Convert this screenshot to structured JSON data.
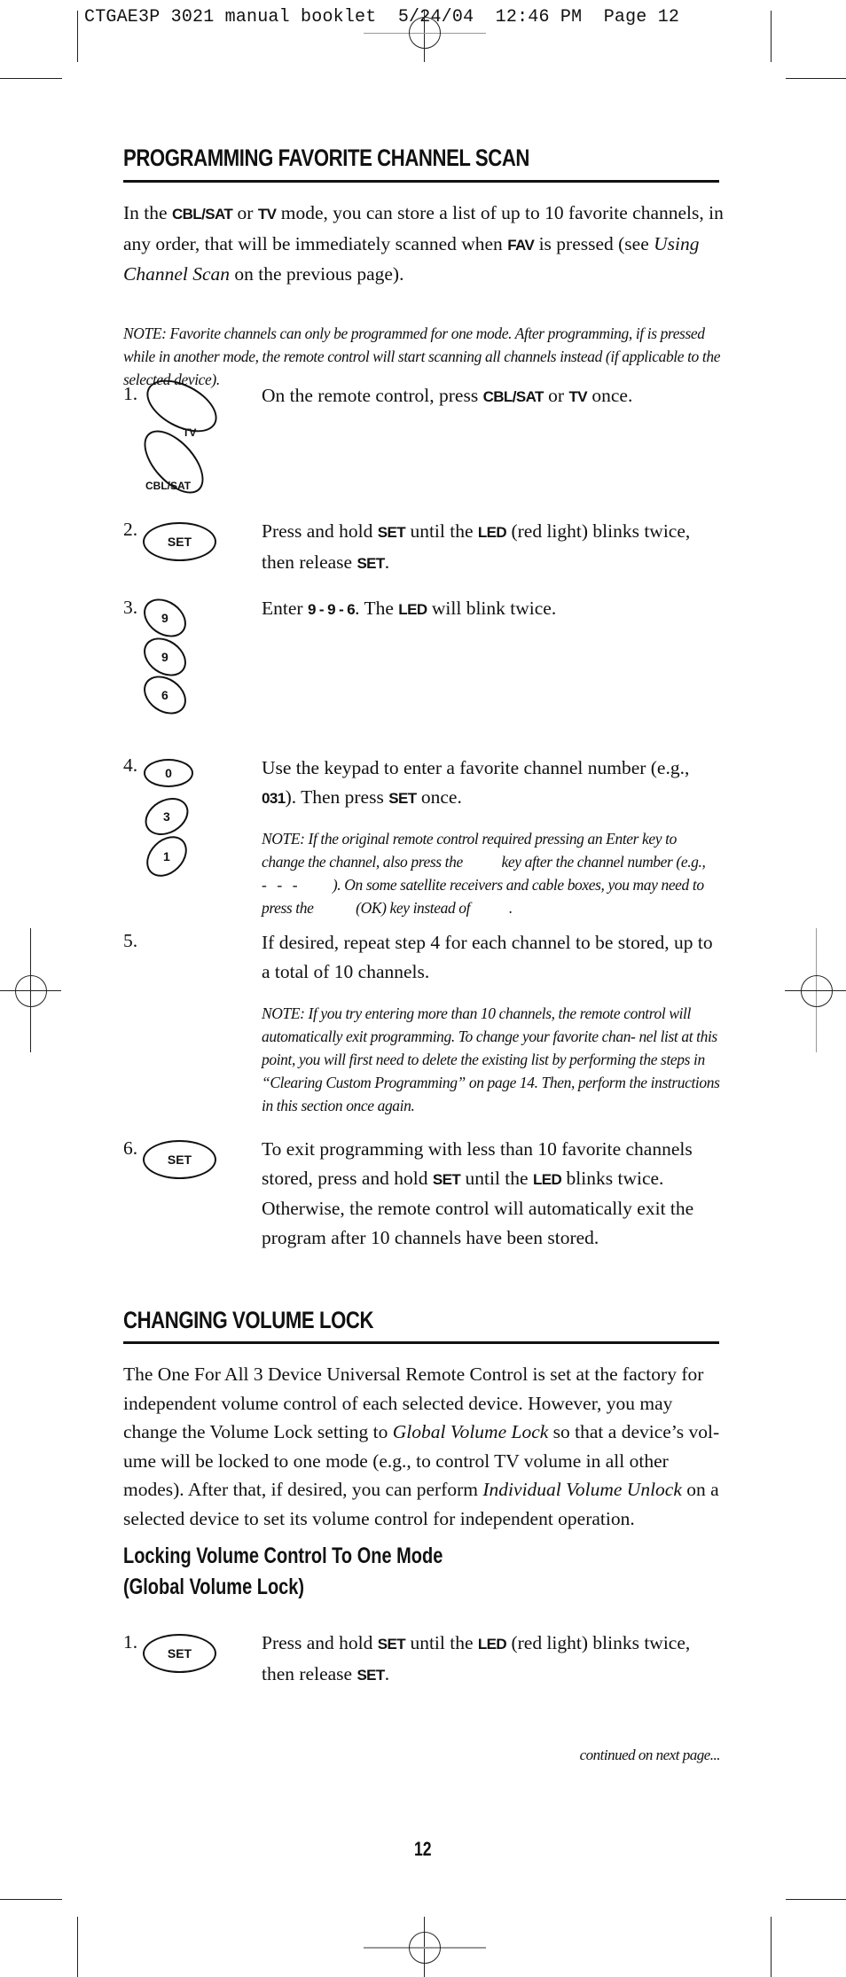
{
  "slug_line": "CTGAE3P 3021 manual booklet  5/24/04  12:46 PM  Page 12",
  "section1": {
    "title": "PROGRAMMING FAVORITE CHANNEL SCAN",
    "intro": {
      "t1": "In the ",
      "k1": "CBL/SAT",
      "t2": " or ",
      "k2": "TV",
      "t3": " mode, you can store a list of up to 10 favorite channels, in any order, that will be immediately scanned when ",
      "k3": "FAV",
      "t4": " is pressed (see ",
      "i1": "Using Channel Scan",
      "t5": " on the previous page)."
    },
    "note": "NOTE: Favorite channels can only be programmed for one mode. After programming, if is pressed while in another mode, the remote control will start scanning all channels instead (if applicable to the selected device).",
    "steps": [
      {
        "number": "1.",
        "keys": [
          "TV",
          "CBL/SAT"
        ],
        "t1": "On the remote control, press ",
        "k1": "CBL/SAT",
        "t2": " or ",
        "k2": "TV",
        "t3": " once."
      },
      {
        "number": "2.",
        "keys": [
          "SET"
        ],
        "t1": "Press and hold ",
        "k1": "SET",
        "t2": " until the ",
        "k2": "LED",
        "t3": " (red light) blinks twice, then release ",
        "k3": "SET",
        "t4": "."
      },
      {
        "number": "3.",
        "keys": [
          "9",
          "9",
          "6"
        ],
        "t1": "Enter ",
        "k1": "9 - 9 - 6",
        "t2": ". The ",
        "k2": "LED",
        "t3": " will blink twice."
      },
      {
        "number": "4.",
        "keys": [
          "0",
          "3",
          "1"
        ],
        "t1": "Use the keypad to enter a favorite channel number (e.g., ",
        "k1": "031",
        "t2": "). Then press ",
        "k2": "SET",
        "t3": " once.",
        "note": "NOTE: If the original remote control required pressing an Enter key to change the channel, also press the           key after the channel number (e.g.,    -   -   -          ). On some satellite receivers and cable boxes, you may need to press the            (OK) key instead of           ."
      },
      {
        "number": "5.",
        "text": "If desired, repeat step 4 for each channel to be stored, up to a total of 10 channels.",
        "note": "NOTE: If you try entering more than 10 channels, the remote control will automatically exit programming. To change your favorite chan- nel list at this point, you will first need to delete the existing list by performing the steps in “Clearing Custom Programming” on page 14. Then, perform the instructions in this section once again."
      },
      {
        "number": "6.",
        "keys": [
          "SET"
        ],
        "t1": "To exit programming with less than 10 favorite channels stored, press and hold ",
        "k1": "SET",
        "t2": " until the ",
        "k2": "LED",
        "t3": " blinks twice. Otherwise, the remote control will automatically exit the program after 10 channels have been stored."
      }
    ]
  },
  "section2": {
    "title": "CHANGING VOLUME LOCK",
    "intro": {
      "t1": "The One For All 3 Device Universal Remote Control is set at the factory for independent volume control of each selected device. However, you may change the Volume Lock setting to ",
      "i1": "Global Volume Lock",
      "t2": " so that a device’s vol- ume will be locked to one mode (e.g., to control TV volume in all other modes). After that, if desired, you can perform ",
      "i2": "Individual Volume Unlock",
      "t3": " on a selected device to set its volume control for independent operation."
    },
    "subtitle_line1": "Locking Volume Control To One Mode",
    "subtitle_line2": "(Global Volume Lock)",
    "steps": [
      {
        "number": "1.",
        "keys": [
          "SET"
        ],
        "t1": "Press and hold ",
        "k1": "SET",
        "t2": " until the ",
        "k2": "LED",
        "t3": " (red light) blinks twice, then release ",
        "k3": "SET",
        "t4": "."
      }
    ]
  },
  "continued": "continued on next page...",
  "page_number": "12"
}
